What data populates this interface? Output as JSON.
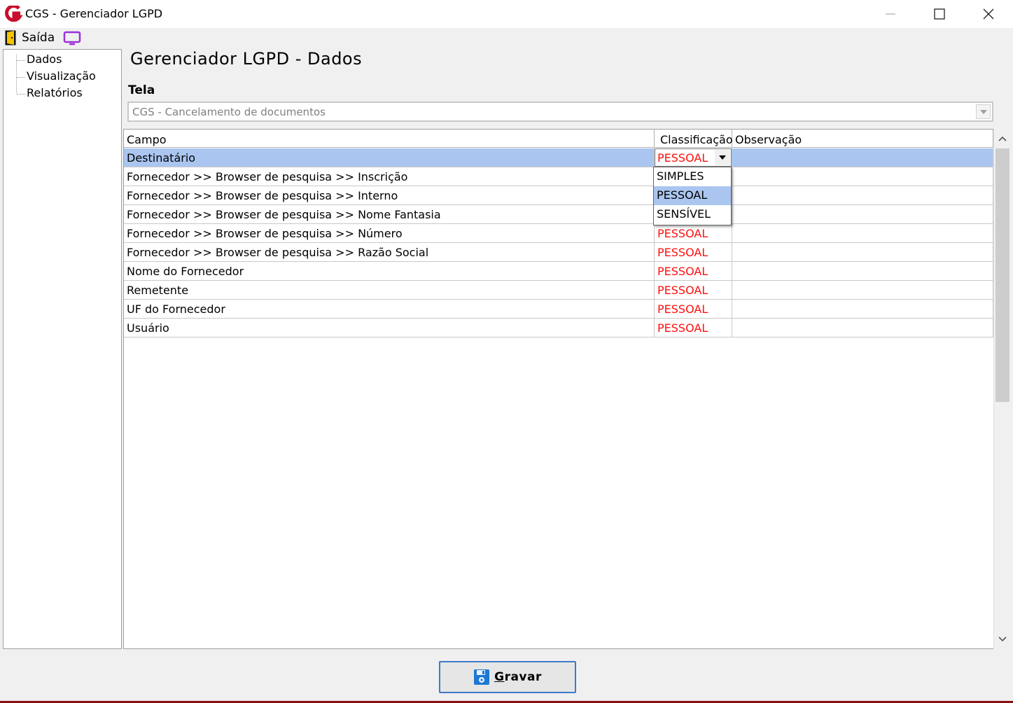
{
  "window": {
    "title": "CGS - Gerenciador LGPD"
  },
  "menu": {
    "exit_label": "Saída"
  },
  "tree": {
    "items": [
      {
        "label": "Dados"
      },
      {
        "label": "Visualização"
      },
      {
        "label": "Relatórios"
      }
    ]
  },
  "main": {
    "title": "Gerenciador LGPD - Dados",
    "tela_label": "Tela",
    "tela_value": "CGS - Cancelamento de documentos"
  },
  "grid": {
    "columns": [
      "Campo",
      "Classificação",
      "Observação"
    ],
    "rows": [
      {
        "campo": "Destinatário",
        "classificacao": "PESSOAL",
        "observacao": ""
      },
      {
        "campo": "Fornecedor >> Browser de pesquisa >> Inscrição",
        "classificacao": "",
        "observacao": ""
      },
      {
        "campo": "Fornecedor >> Browser de pesquisa >> Interno",
        "classificacao": "",
        "observacao": ""
      },
      {
        "campo": "Fornecedor >> Browser de pesquisa >> Nome Fantasia",
        "classificacao": "",
        "observacao": ""
      },
      {
        "campo": "Fornecedor >> Browser de pesquisa >> Número",
        "classificacao": "PESSOAL",
        "observacao": ""
      },
      {
        "campo": "Fornecedor >> Browser de pesquisa >> Razão Social",
        "classificacao": "PESSOAL",
        "observacao": ""
      },
      {
        "campo": "Nome do Fornecedor",
        "classificacao": "PESSOAL",
        "observacao": ""
      },
      {
        "campo": "Remetente",
        "classificacao": "PESSOAL",
        "observacao": ""
      },
      {
        "campo": "UF do Fornecedor",
        "classificacao": "PESSOAL",
        "observacao": ""
      },
      {
        "campo": "Usuário",
        "classificacao": "PESSOAL",
        "observacao": ""
      }
    ],
    "editor_value": "PESSOAL",
    "dropdown_options": [
      "SIMPLES",
      "PESSOAL",
      "SENSÍVEL"
    ],
    "dropdown_selected": "PESSOAL"
  },
  "footer": {
    "save_label_underlined": "G",
    "save_label_rest": "ravar"
  },
  "colors": {
    "classification_text": "#ff1010",
    "selection": "#aac6f0",
    "save_border": "#3c7ac8",
    "logo_red": "#c8102e"
  }
}
